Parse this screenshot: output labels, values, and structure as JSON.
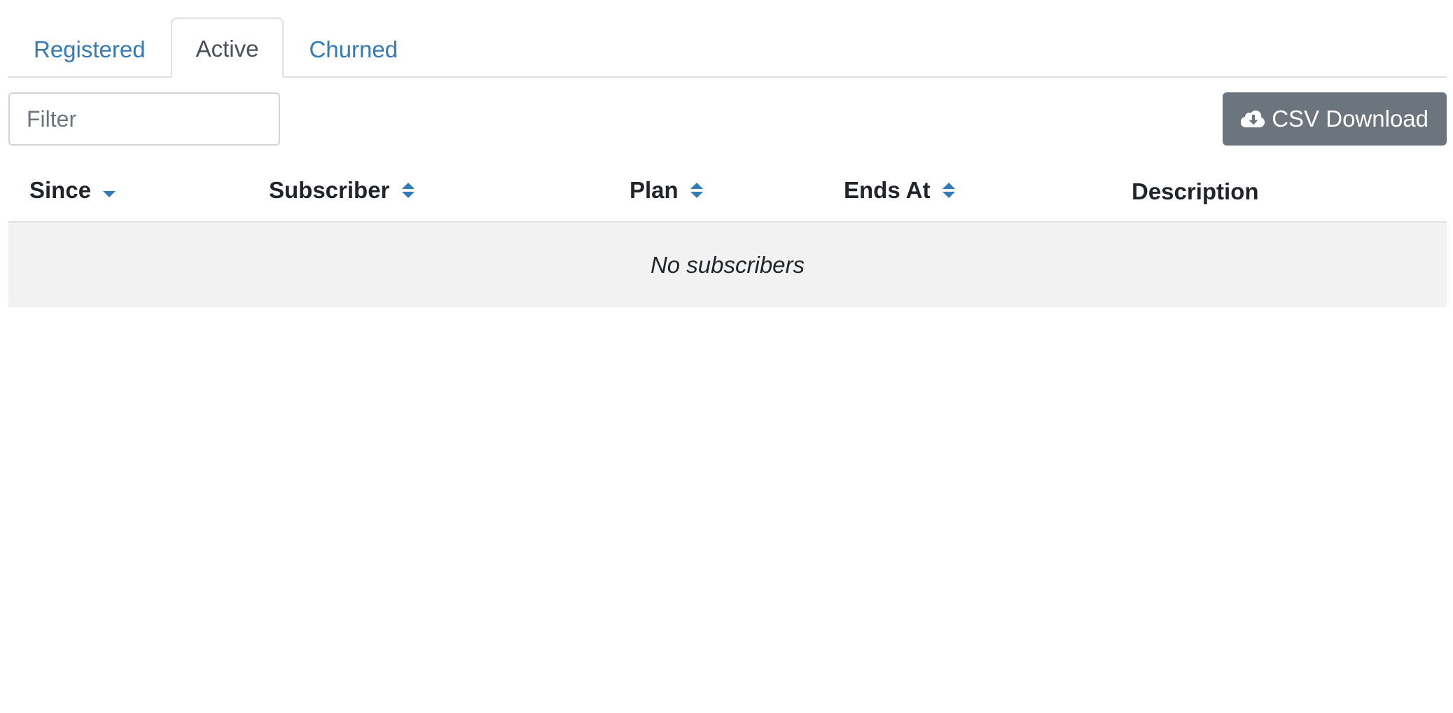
{
  "tabs": [
    {
      "label": "Registered",
      "active": false
    },
    {
      "label": "Active",
      "active": true
    },
    {
      "label": "Churned",
      "active": false
    }
  ],
  "toolbar": {
    "filter_placeholder": "Filter",
    "filter_value": "",
    "csv_label": "CSV Download",
    "csv_icon": "cloud-download-icon"
  },
  "table": {
    "columns": [
      {
        "label": "Since",
        "sort": "descending"
      },
      {
        "label": "Subscriber",
        "sort": "sortable"
      },
      {
        "label": "Plan",
        "sort": "sortable"
      },
      {
        "label": "Ends At",
        "sort": "sortable"
      },
      {
        "label": "Description",
        "sort": "none"
      }
    ],
    "empty_message": "No subscribers"
  },
  "colors": {
    "link": "#337ab7",
    "button_bg": "#6c757d",
    "empty_row_bg": "#f2f2f2"
  }
}
